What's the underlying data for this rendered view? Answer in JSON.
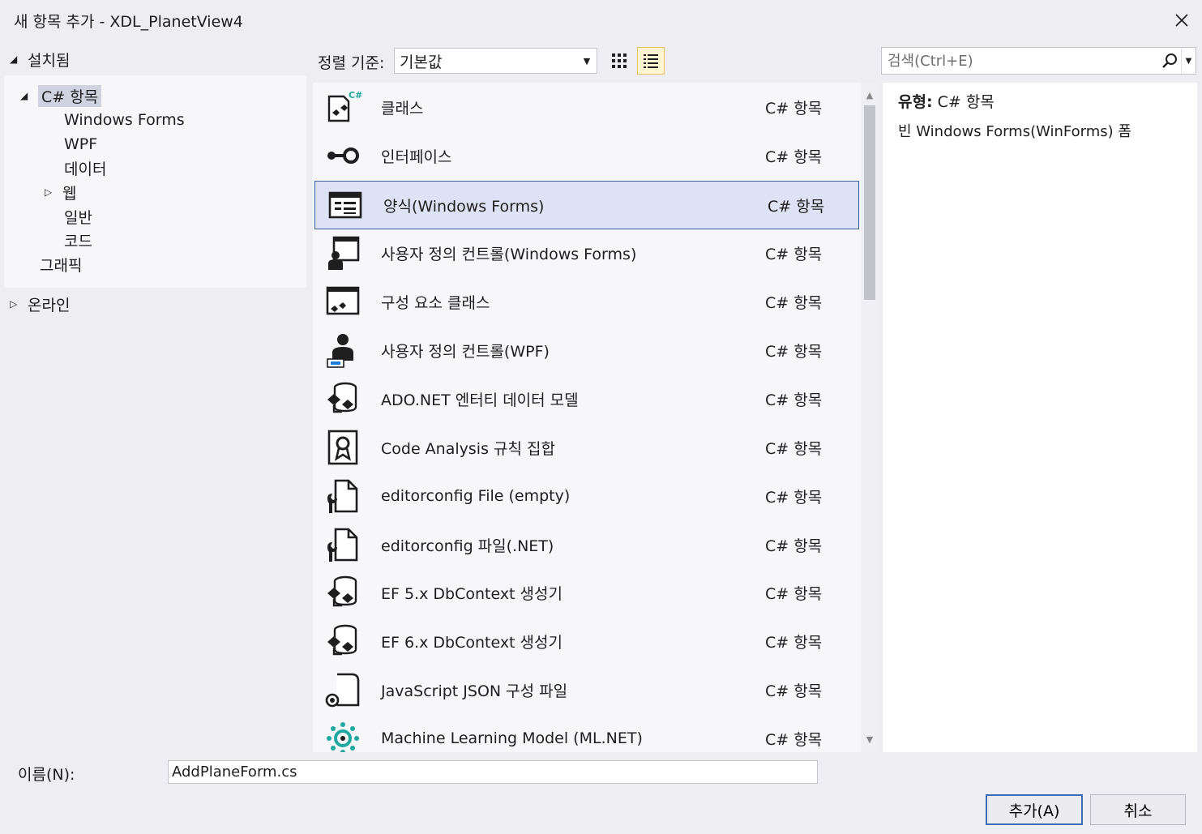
{
  "window": {
    "title": "새 항목 추가 - XDL_PlanetView4"
  },
  "tree": {
    "installed_label": "설치됨",
    "items": [
      {
        "label": "C# 항목"
      },
      {
        "label": "Windows Forms"
      },
      {
        "label": "WPF"
      },
      {
        "label": "데이터"
      },
      {
        "label": "웹"
      },
      {
        "label": "일반"
      },
      {
        "label": "코드"
      },
      {
        "label": "그래픽"
      }
    ],
    "online_label": "온라인"
  },
  "toolbar": {
    "sort_label": "정렬 기준:",
    "sort_value": "기본값",
    "search_placeholder": "검색(Ctrl+E)"
  },
  "templates": [
    {
      "name": "클래스",
      "category": "C# 항목",
      "icon": "class-icon"
    },
    {
      "name": "인터페이스",
      "category": "C# 항목",
      "icon": "interface-icon"
    },
    {
      "name": "양식(Windows Forms)",
      "category": "C# 항목",
      "icon": "form-icon"
    },
    {
      "name": "사용자 정의 컨트롤(Windows Forms)",
      "category": "C# 항목",
      "icon": "user-control-icon"
    },
    {
      "name": "구성 요소 클래스",
      "category": "C# 항목",
      "icon": "component-class-icon"
    },
    {
      "name": "사용자 정의 컨트롤(WPF)",
      "category": "C# 항목",
      "icon": "wpf-user-control-icon"
    },
    {
      "name": "ADO.NET 엔터티 데이터 모델",
      "category": "C# 항목",
      "icon": "entity-model-icon"
    },
    {
      "name": "Code Analysis 규칙 집합",
      "category": "C# 항목",
      "icon": "ruleset-icon"
    },
    {
      "name": "editorconfig File (empty)",
      "category": "C# 항목",
      "icon": "editorconfig-icon"
    },
    {
      "name": "editorconfig 파일(.NET)",
      "category": "C# 항목",
      "icon": "editorconfig-icon"
    },
    {
      "name": "EF 5.x DbContext 생성기",
      "category": "C# 항목",
      "icon": "dbcontext-icon"
    },
    {
      "name": "EF 6.x DbContext 생성기",
      "category": "C# 항목",
      "icon": "dbcontext-icon"
    },
    {
      "name": "JavaScript JSON 구성 파일",
      "category": "C# 항목",
      "icon": "json-config-icon"
    },
    {
      "name": "Machine Learning Model (ML.NET)",
      "category": "C# 항목",
      "icon": "ml-model-icon"
    }
  ],
  "selected_index": 2,
  "detail": {
    "type_label": "유형:",
    "type_value": "C# 항목",
    "description": "빈 Windows Forms(WinForms) 폼"
  },
  "footer": {
    "name_label": "이름(N):",
    "name_value": "AddPlaneForm.cs",
    "add_label": "추가(A)",
    "cancel_label": "취소"
  },
  "colors": {
    "accent": "#3d5d9e",
    "selection": "#dde2f4",
    "teal": "#1ea8a0",
    "background": "#eeeef2"
  }
}
